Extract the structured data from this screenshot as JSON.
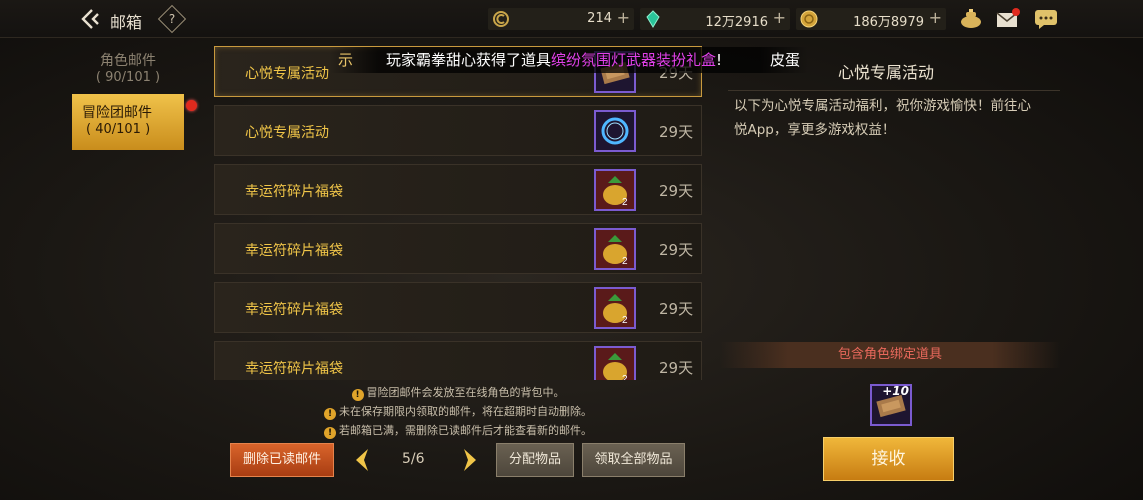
{
  "header": {
    "title": "邮箱",
    "help_label": "?",
    "resources": [
      {
        "icon": "energy-coin-icon",
        "value": "214",
        "plus": "+"
      },
      {
        "icon": "green-gem-icon",
        "value": "12万2916",
        "plus": "+"
      },
      {
        "icon": "gold-coin-icon",
        "value": "186万8979",
        "plus": "+"
      }
    ],
    "icons": [
      "teapot-icon",
      "mail-notify-icon",
      "chat-icon"
    ]
  },
  "broadcast": {
    "prefix": "示",
    "text_before": "玩家霸拳甜心获得了道具",
    "item": "缤纷氛围灯武器装扮礼盒",
    "text_after": "!",
    "tail": "皮蛋"
  },
  "tabs": [
    {
      "label": "角色邮件",
      "count": "( 90/101 )",
      "active": false
    },
    {
      "label": "冒险团邮件",
      "count": "( 40/101 )",
      "active": true
    }
  ],
  "mails": [
    {
      "title": "心悦专属活动",
      "item_icon": "wooden-token-icon",
      "days": "29天",
      "selected": true
    },
    {
      "title": "心悦专属活动",
      "item_icon": "blue-ring-icon",
      "days": "29天",
      "selected": false
    },
    {
      "title": "幸运符碎片福袋",
      "item_icon": "lucky-bag-icon",
      "days": "29天",
      "selected": false
    },
    {
      "title": "幸运符碎片福袋",
      "item_icon": "lucky-bag-icon",
      "days": "29天",
      "selected": false
    },
    {
      "title": "幸运符碎片福袋",
      "item_icon": "lucky-bag-icon",
      "days": "29天",
      "selected": false
    },
    {
      "title": "幸运符碎片福袋",
      "item_icon": "lucky-bag-icon",
      "days": "29天",
      "selected": false
    }
  ],
  "notes": [
    "冒险团邮件会发放至在线角色的背包中。",
    "未在保存期限内领取的邮件，将在超期时自动删除。",
    "若邮箱已满，需删除已读邮件后才能查看新的邮件。"
  ],
  "controls": {
    "delete_read": "删除已读邮件",
    "page": "5/6",
    "distribute": "分配物品",
    "claim_all": "领取全部物品"
  },
  "detail": {
    "title": "心悦专属活动",
    "body": "以下为心悦专属活动福利，祝你游戏愉快！前往心悦App，享更多游戏权益！",
    "bound_notice": "包含角色绑定道具",
    "reward": {
      "icon": "wooden-token-icon",
      "count": "+10"
    },
    "claim": "接收"
  },
  "colors": {
    "gold_text": "#f0c548",
    "accent_orange": "#d9642b",
    "claim_gold": "#f0b73a",
    "broadcast_item": "#e040e8",
    "warning_red": "#e9695c"
  }
}
